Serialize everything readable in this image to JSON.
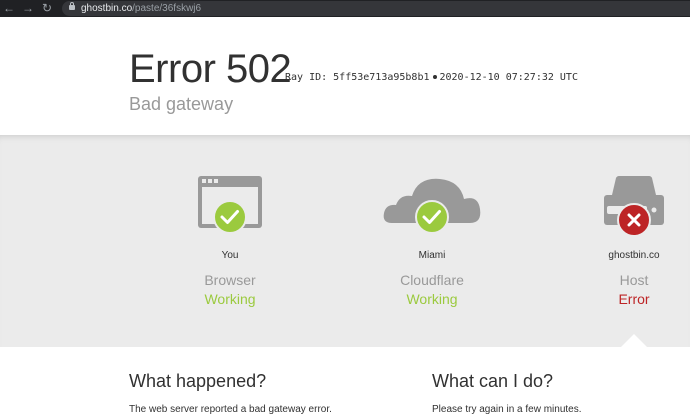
{
  "browser": {
    "url_host": "ghostbin.co",
    "url_path": "/paste/36fskwj6",
    "back_icon": "back-arrow-icon",
    "forward_icon": "forward-arrow-icon",
    "reload_icon": "reload-icon"
  },
  "header": {
    "error": "Error 502",
    "ray_id": "Ray ID: 5ff53e713a95b8b1",
    "timestamp": "2020-12-10 07:27:32 UTC",
    "subtitle": "Bad gateway"
  },
  "status": [
    {
      "location": "You",
      "kind": "Browser",
      "state": "Working",
      "ok": true,
      "icon": "browser-window-icon"
    },
    {
      "location": "Miami",
      "kind": "Cloudflare",
      "state": "Working",
      "ok": true,
      "icon": "cloud-icon"
    },
    {
      "location": "ghostbin.co",
      "kind": "Host",
      "state": "Error",
      "ok": false,
      "icon": "server-icon"
    }
  ],
  "what_happened": {
    "title": "What happened?",
    "text": "The web server reported a bad gateway error."
  },
  "what_can_i_do": {
    "title": "What can I do?",
    "text": "Please try again in a few minutes."
  },
  "colors": {
    "working": "#9bca3e",
    "error": "#bd2426",
    "icon_gray": "#999999"
  }
}
